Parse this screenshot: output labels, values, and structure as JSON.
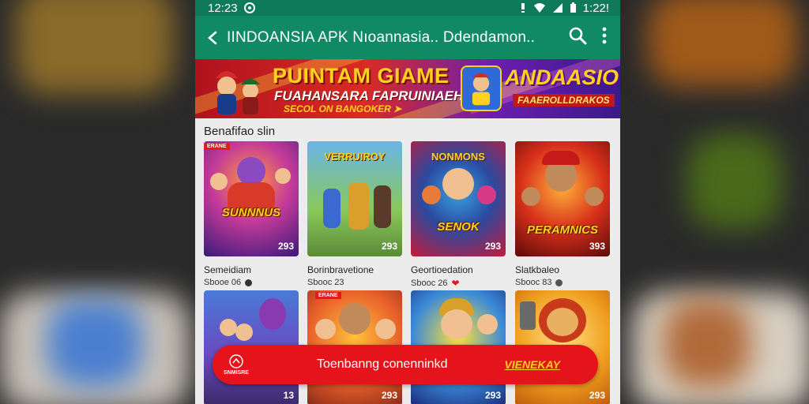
{
  "status_bar": {
    "time_left": "12:23",
    "time_right": "1:22!"
  },
  "app_bar": {
    "title": "IINDOANSIA  APK  Nıoannasia.. Ddendamon.."
  },
  "banner": {
    "headline": "PUINTAM GIAME",
    "subline": "FUAHANSARA FAPRUINIAEHI",
    "cta": "SECOL ON BANGOKER ➤",
    "brand": "ANDAASIO",
    "brand_sub": "FAAEROLLDRAKOS"
  },
  "section": {
    "title": "Benafifao slin"
  },
  "games": [
    {
      "art_title": "SUNNNUS",
      "art_top": "",
      "number": "293",
      "tag": "ERANE",
      "name": "Semeidiam",
      "meta": "Sbooe 06",
      "dot": "#333333"
    },
    {
      "art_title": "",
      "art_top": "VERRUIROY",
      "number": "293",
      "tag": "",
      "name": "Borinbravetione",
      "meta": "Sbooc 23",
      "dot": ""
    },
    {
      "art_title": "SENOK",
      "art_top": "NONMONS",
      "number": "293",
      "tag": "",
      "name": "Geortioedation",
      "meta": "Sbooc 26",
      "dot": "#e31b1b"
    },
    {
      "art_title": "PERAMNICS",
      "art_top": "",
      "number": "393",
      "tag": "",
      "name": "Slatkbaleo",
      "meta": "Sbooc 83",
      "dot": "#555555"
    },
    {
      "art_title": "",
      "art_top": "",
      "number": "13",
      "tag": "",
      "name": "",
      "meta": "",
      "dot": ""
    },
    {
      "art_title": "",
      "art_top": "",
      "number": "293",
      "tag": "ERANE",
      "name": "",
      "meta": "",
      "dot": ""
    },
    {
      "art_title": "",
      "art_top": "",
      "number": "293",
      "tag": "",
      "name": "",
      "meta": "",
      "dot": ""
    },
    {
      "art_title": "",
      "art_top": "",
      "number": "293",
      "tag": "",
      "name": "",
      "meta": "",
      "dot": ""
    }
  ],
  "toast": {
    "icon_label": "SNMISRE",
    "message": "Toenbanng conenninkd",
    "action": "VIENEKAY"
  },
  "colors": {
    "app_bar": "#0f8a63",
    "status_bar": "#0e7a5a",
    "accent_red": "#e4141a",
    "gold": "#ffd21f"
  }
}
